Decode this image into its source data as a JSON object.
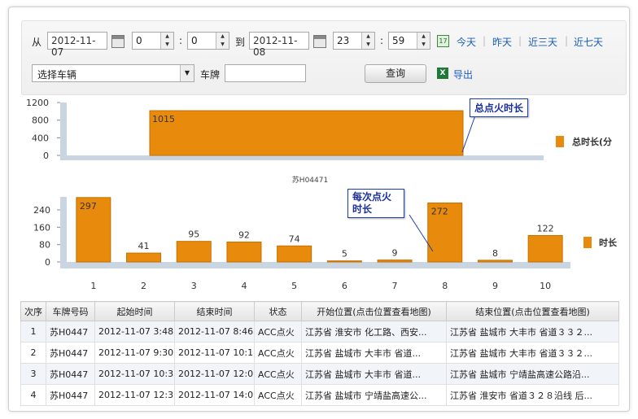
{
  "filters": {
    "from_label": "从",
    "to_label": "到",
    "start_date": "2012-11-07",
    "start_hour": "0",
    "start_minute": "0",
    "end_date": "2012-11-08",
    "end_hour": "23",
    "end_minute": "59",
    "colon": ":",
    "quick_links": [
      "今天",
      "昨天",
      "近三天",
      "近七天"
    ],
    "vehicle_select": "选择车辆",
    "plate_label": "车牌",
    "plate_value": "",
    "query_button": "查询",
    "export_label": "导出"
  },
  "chart_data": [
    {
      "type": "bar",
      "categories": [
        ""
      ],
      "values": [
        1015
      ],
      "ylim": [
        0,
        1200
      ],
      "yticks": [
        0,
        400,
        800,
        1200
      ],
      "legend": "总时长(分",
      "xlabel": "苏H04471",
      "callout": "总点火时长",
      "color": "#e88a0c"
    },
    {
      "type": "bar",
      "categories": [
        "1",
        "2",
        "3",
        "4",
        "5",
        "6",
        "7",
        "8",
        "9",
        "10"
      ],
      "values": [
        297,
        41,
        95,
        92,
        74,
        5,
        9,
        272,
        8,
        122
      ],
      "ylim": [
        0,
        300
      ],
      "yticks": [
        0,
        80,
        160,
        240
      ],
      "legend": "时长",
      "callout": "每次点火时长",
      "color": "#e88a0c"
    }
  ],
  "table": {
    "columns": [
      "次序",
      "车牌号码",
      "起始时间",
      "结束时间",
      "状态",
      "开始位置(点击位置查看地图)",
      "结束位置(点击位置查看地图)"
    ],
    "rows": [
      [
        "1",
        "苏H0447",
        "2012-11-07 3:48",
        "2012-11-07 8:46",
        "ACC点火",
        "江苏省 淮安市 化工路、西安...",
        "江苏省 盐城市 大丰市 省道３３２..."
      ],
      [
        "2",
        "苏H0447",
        "2012-11-07 9:30",
        "2012-11-07 10:1",
        "ACC点火",
        "江苏省 盐城市 大丰市 省道...",
        "江苏省 盐城市 大丰市 省道３３２..."
      ],
      [
        "3",
        "苏H0447",
        "2012-11-07 10:3",
        "2012-11-07 12:0",
        "ACC点火",
        "江苏省 盐城市 大丰市 省道...",
        "江苏省 盐城市 宁靖盐高速公路沿..."
      ],
      [
        "4",
        "苏H0447",
        "2012-11-07 12:3",
        "2012-11-07 14:0",
        "ACC点火",
        "江苏省 盐城市 宁靖盐高速公...",
        "江苏省 淮安市 省道３２８沿线 后..."
      ]
    ]
  }
}
